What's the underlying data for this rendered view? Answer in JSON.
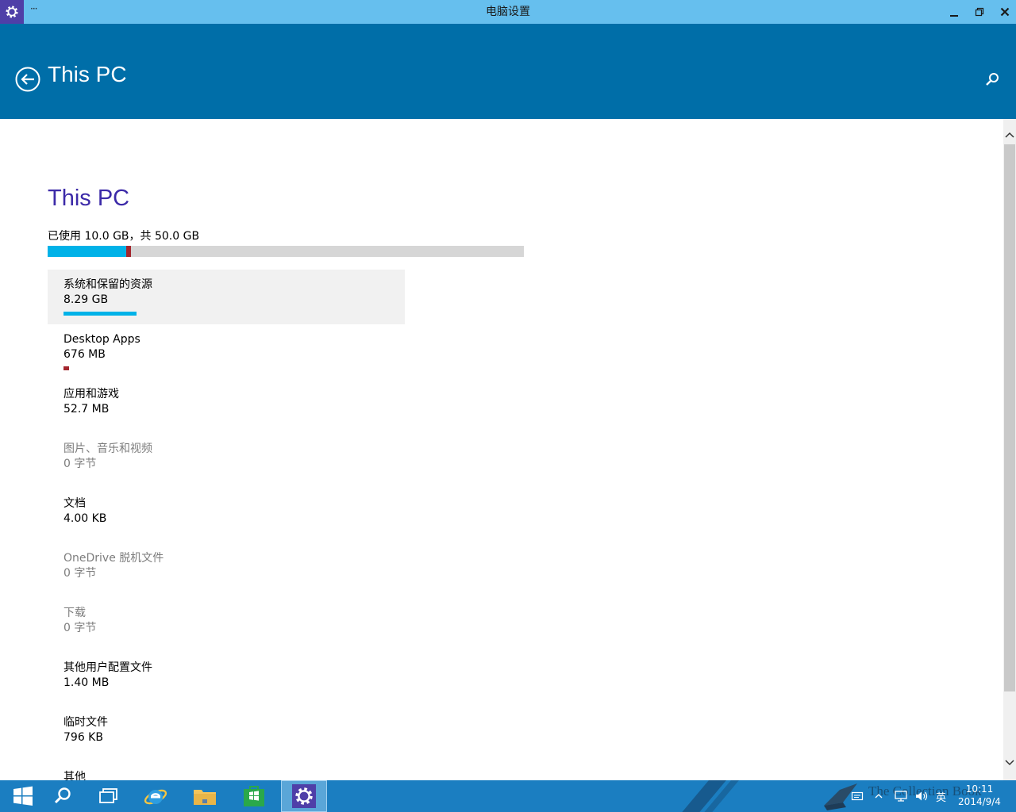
{
  "window": {
    "title": "电脑设置",
    "menu_label": "···"
  },
  "header": {
    "title": "This PC"
  },
  "page": {
    "title": "This PC",
    "usage_text": "已使用 10.0 GB，共 50.0 GB",
    "usage_fraction": 0.2,
    "system_fraction": 0.1658,
    "apps_fraction": 0.0135
  },
  "categories": [
    {
      "name": "系统和保留的资源",
      "size": "8.29 GB",
      "selected": true,
      "dim": false,
      "bar_fraction": 0.1658,
      "bar_color": "#00b2e8"
    },
    {
      "name": "Desktop Apps",
      "size": "676 MB",
      "selected": false,
      "dim": false,
      "bar_fraction": 0.0135,
      "bar_color": "#a3262e"
    },
    {
      "name": "应用和游戏",
      "size": "52.7 MB",
      "selected": false,
      "dim": false,
      "bar_fraction": 0,
      "bar_color": ""
    },
    {
      "name": "图片、音乐和视频",
      "size": "0 字节",
      "selected": false,
      "dim": true,
      "bar_fraction": 0,
      "bar_color": ""
    },
    {
      "name": "文档",
      "size": "4.00 KB",
      "selected": false,
      "dim": false,
      "bar_fraction": 0,
      "bar_color": ""
    },
    {
      "name": "OneDrive 脱机文件",
      "size": "0 字节",
      "selected": false,
      "dim": true,
      "bar_fraction": 0,
      "bar_color": ""
    },
    {
      "name": "下载",
      "size": "0 字节",
      "selected": false,
      "dim": true,
      "bar_fraction": 0,
      "bar_color": ""
    },
    {
      "name": "其他用户配置文件",
      "size": "1.40 MB",
      "selected": false,
      "dim": false,
      "bar_fraction": 0,
      "bar_color": ""
    },
    {
      "name": "临时文件",
      "size": "796 KB",
      "selected": false,
      "dim": false,
      "bar_fraction": 0,
      "bar_color": ""
    },
    {
      "name": "其他",
      "size": "",
      "selected": false,
      "dim": false,
      "bar_fraction": 0,
      "bar_color": ""
    }
  ],
  "taskbar": {
    "apps": [
      "start-icon",
      "search-icon",
      "task-view-icon",
      "internet-explorer-icon",
      "file-explorer-icon",
      "store-icon",
      "settings-icon"
    ],
    "ime": "英",
    "time": "10:11",
    "date": "2014/9/4",
    "watermark": "The Collection Book"
  },
  "colors": {
    "title_bar": "#66bfee",
    "header": "#006ea8",
    "accent_title": "#3c2aa8",
    "system_bar": "#00b2e8",
    "apps_bar": "#a3262e",
    "taskbar": "#1b7ec1"
  }
}
